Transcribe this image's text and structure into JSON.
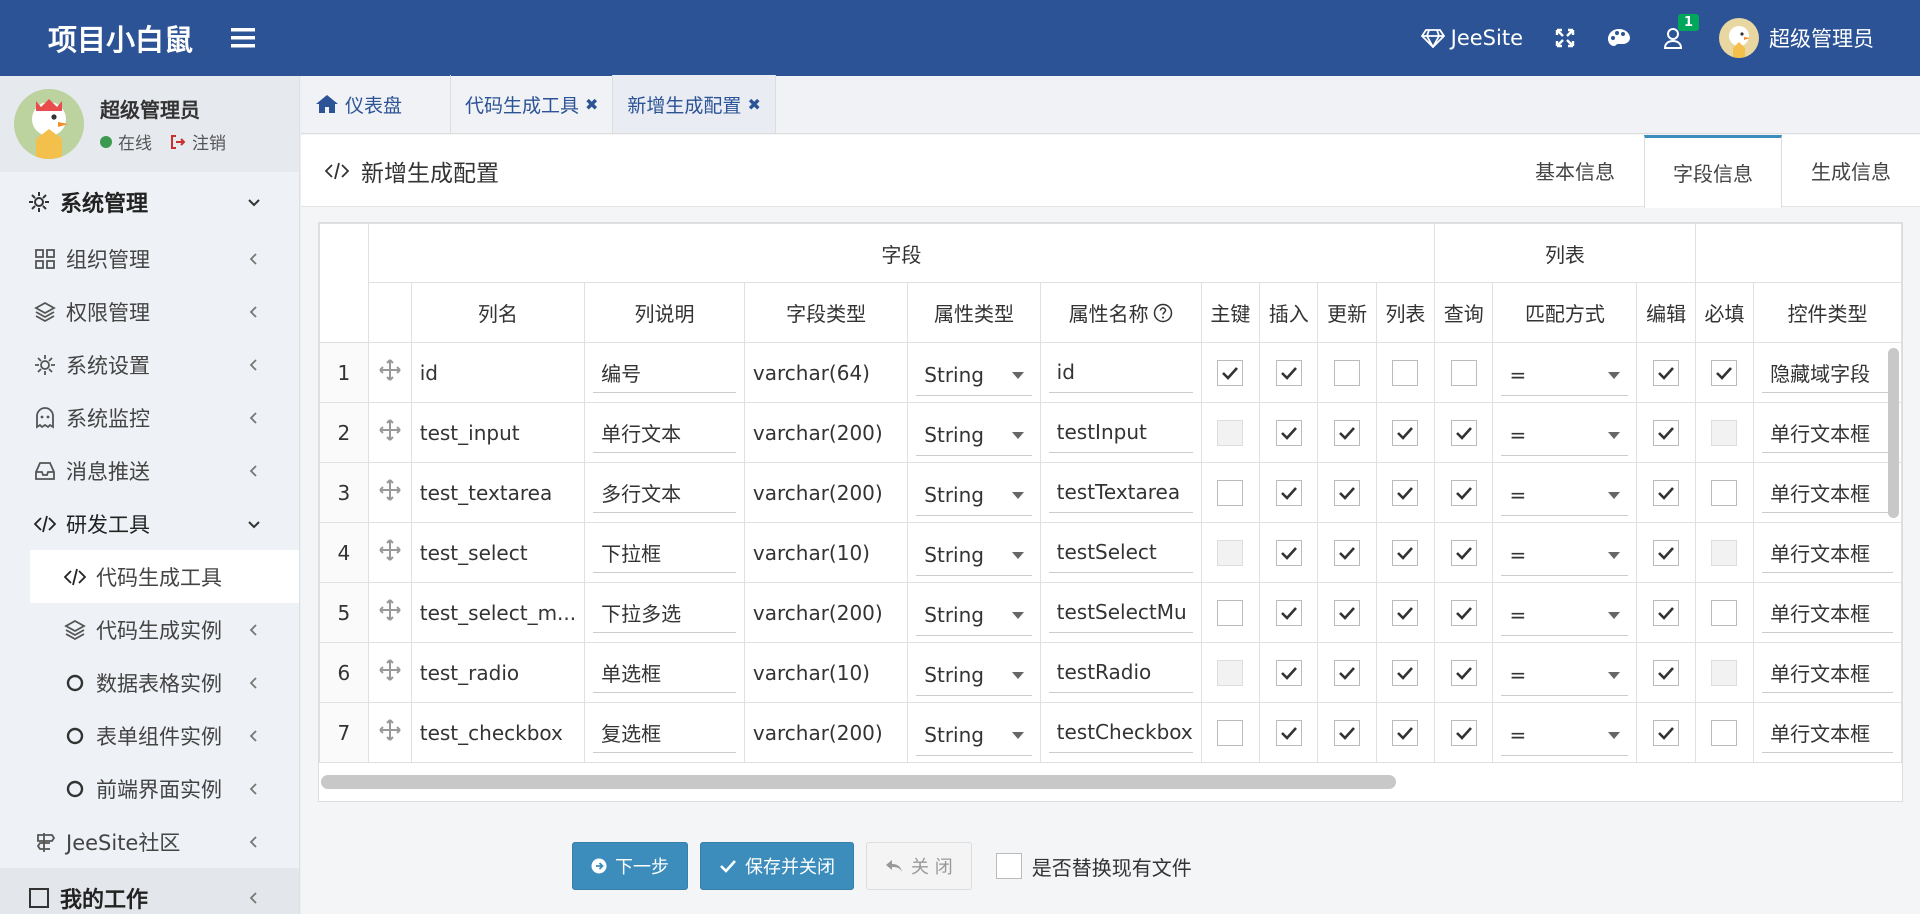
{
  "app": {
    "title": "项目小白鼠"
  },
  "header": {
    "brand": "JeeSite",
    "notify_count": "1",
    "user_name": "超级管理员"
  },
  "user_panel": {
    "name": "超级管理员",
    "status": "在线",
    "logout": "注销"
  },
  "sidebar": {
    "items": [
      {
        "label": "系统管理",
        "icon": "gear-icon"
      },
      {
        "label": "组织管理",
        "icon": "grid-icon"
      },
      {
        "label": "权限管理",
        "icon": "layers-icon"
      },
      {
        "label": "系统设置",
        "icon": "gear-icon"
      },
      {
        "label": "系统监控",
        "icon": "ghost-icon"
      },
      {
        "label": "消息推送",
        "icon": "inbox-icon"
      },
      {
        "label": "研发工具",
        "icon": "code-icon"
      },
      {
        "label": "代码生成工具",
        "icon": "code-icon"
      },
      {
        "label": "代码生成实例",
        "icon": "layers-icon"
      },
      {
        "label": "数据表格实例",
        "icon": "circle-icon"
      },
      {
        "label": "表单组件实例",
        "icon": "circle-icon"
      },
      {
        "label": "前端界面实例",
        "icon": "circle-icon"
      },
      {
        "label": "JeeSite社区",
        "icon": "signpost-icon"
      },
      {
        "label": "我的工作",
        "icon": "checkbox-icon"
      }
    ]
  },
  "tabs": [
    {
      "label": "仪表盘"
    },
    {
      "label": "代码生成工具"
    },
    {
      "label": "新增生成配置"
    }
  ],
  "page": {
    "title": "新增生成配置"
  },
  "form_tabs": [
    {
      "label": "基本信息"
    },
    {
      "label": "字段信息"
    },
    {
      "label": "生成信息"
    }
  ],
  "grid": {
    "groups": {
      "field": "字段",
      "list": "列表"
    },
    "columns": {
      "name": "列名",
      "comment": "列说明",
      "type": "字段类型",
      "attr_type": "属性类型",
      "attr_name": "属性名称",
      "pk": "主键",
      "insert": "插入",
      "update": "更新",
      "list": "列表",
      "query": "查询",
      "match": "匹配方式",
      "edit": "编辑",
      "required": "必填",
      "control": "控件类型"
    },
    "rows": [
      {
        "n": "1",
        "name": "id",
        "comment": "编号",
        "type": "varchar(64)",
        "attr_type": "String",
        "attr_name": "id",
        "pk": true,
        "pk_dis": false,
        "insert": true,
        "update": false,
        "list": false,
        "query": false,
        "match": "=",
        "edit": true,
        "required": true,
        "req_dis": false,
        "control": "隐藏域字段"
      },
      {
        "n": "2",
        "name": "test_input",
        "comment": "单行文本",
        "type": "varchar(200)",
        "attr_type": "String",
        "attr_name": "testInput",
        "pk": false,
        "pk_dis": true,
        "insert": true,
        "update": true,
        "list": true,
        "query": true,
        "match": "=",
        "edit": true,
        "required": false,
        "req_dis": true,
        "control": "单行文本框"
      },
      {
        "n": "3",
        "name": "test_textarea",
        "comment": "多行文本",
        "type": "varchar(200)",
        "attr_type": "String",
        "attr_name": "testTextarea",
        "pk": false,
        "pk_dis": false,
        "insert": true,
        "update": true,
        "list": true,
        "query": true,
        "match": "=",
        "edit": true,
        "required": false,
        "req_dis": false,
        "control": "单行文本框"
      },
      {
        "n": "4",
        "name": "test_select",
        "comment": "下拉框",
        "type": "varchar(10)",
        "attr_type": "String",
        "attr_name": "testSelect",
        "pk": false,
        "pk_dis": true,
        "insert": true,
        "update": true,
        "list": true,
        "query": true,
        "match": "=",
        "edit": true,
        "required": false,
        "req_dis": true,
        "control": "单行文本框"
      },
      {
        "n": "5",
        "name": "test_select_m...",
        "comment": "下拉多选",
        "type": "varchar(200)",
        "attr_type": "String",
        "attr_name": "testSelectMu",
        "pk": false,
        "pk_dis": false,
        "insert": true,
        "update": true,
        "list": true,
        "query": true,
        "match": "=",
        "edit": true,
        "required": false,
        "req_dis": false,
        "control": "单行文本框"
      },
      {
        "n": "6",
        "name": "test_radio",
        "comment": "单选框",
        "type": "varchar(10)",
        "attr_type": "String",
        "attr_name": "testRadio",
        "pk": false,
        "pk_dis": true,
        "insert": true,
        "update": true,
        "list": true,
        "query": true,
        "match": "=",
        "edit": true,
        "required": false,
        "req_dis": true,
        "control": "单行文本框"
      },
      {
        "n": "7",
        "name": "test_checkbox",
        "comment": "复选框",
        "type": "varchar(200)",
        "attr_type": "String",
        "attr_name": "testCheckbox",
        "pk": false,
        "pk_dis": false,
        "insert": true,
        "update": true,
        "list": true,
        "query": true,
        "match": "=",
        "edit": true,
        "required": false,
        "req_dis": false,
        "control": "单行文本框"
      }
    ]
  },
  "footer": {
    "next": "下一步",
    "save_close": "保存并关闭",
    "close": "关 闭",
    "replace": "是否替换现有文件"
  },
  "colors": {
    "header": "#2c5395",
    "primary": "#3c8dbc",
    "online": "#3c9a50"
  }
}
